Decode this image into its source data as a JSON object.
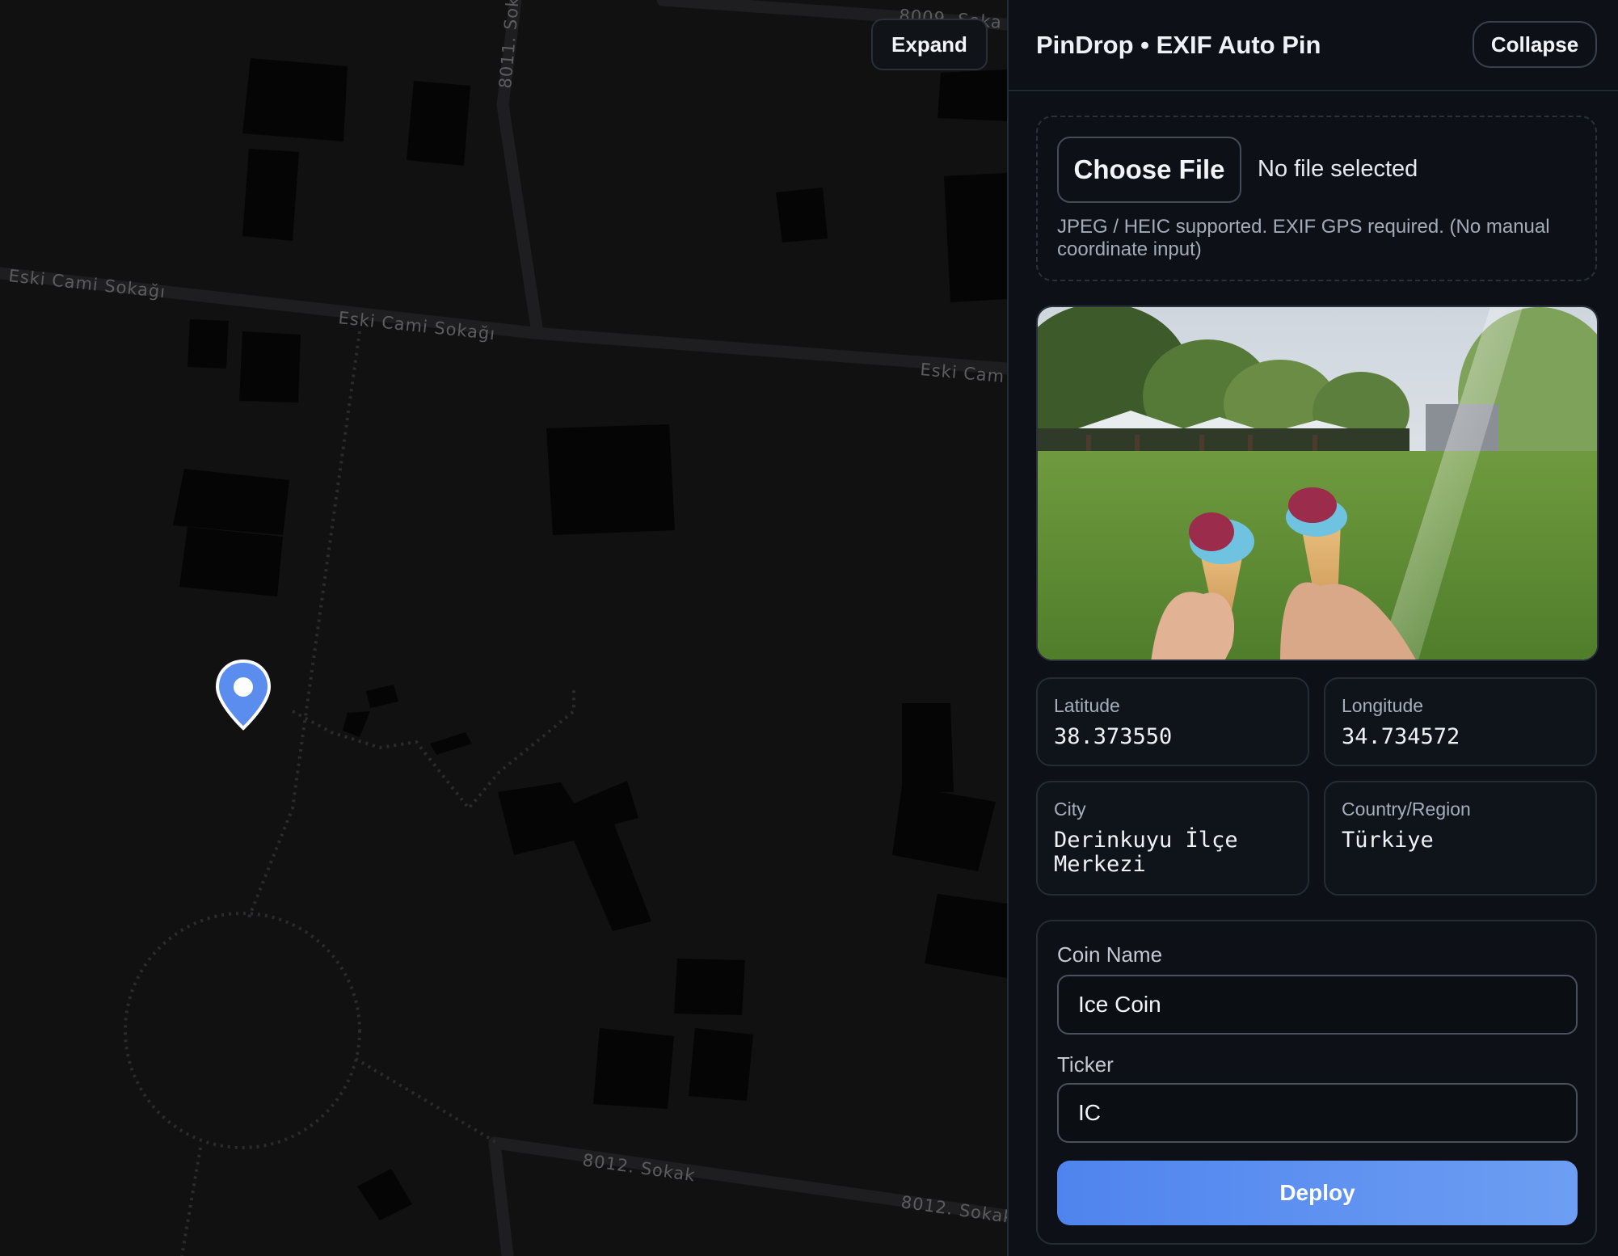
{
  "map": {
    "expand_label": "Expand",
    "streets": {
      "label_1": "Eski Cami Sokağı",
      "label_2": "Eski Cami Sokağı",
      "label_3": "Eski Cam",
      "label_4": "8011. Soka",
      "label_5": "8012. Sokak",
      "label_6": "8012. Sokak",
      "label_7": "8009. Soka"
    }
  },
  "panel": {
    "title": "PinDrop • EXIF Auto Pin",
    "collapse_label": "Collapse",
    "upload": {
      "button_label": "Choose File",
      "status": "No file selected",
      "hint": "JPEG / HEIC supported. EXIF GPS required. (No manual coordinate input)"
    },
    "location": {
      "latitude_label": "Latitude",
      "latitude_value": "38.373550",
      "longitude_label": "Longitude",
      "longitude_value": "34.734572",
      "city_label": "City",
      "city_value": "Derinkuyu İlçe Merkezi",
      "country_label": "Country/Region",
      "country_value": "Türkiye"
    },
    "form": {
      "coin_name_label": "Coin Name",
      "coin_name_value": "Ice Coin",
      "ticker_label": "Ticker",
      "ticker_value": "IC",
      "deploy_label": "Deploy"
    }
  },
  "colors": {
    "accent": "#4f84ee",
    "pin": "#5b8def",
    "panel_bg": "#0d1117",
    "map_bg": "#111112"
  }
}
